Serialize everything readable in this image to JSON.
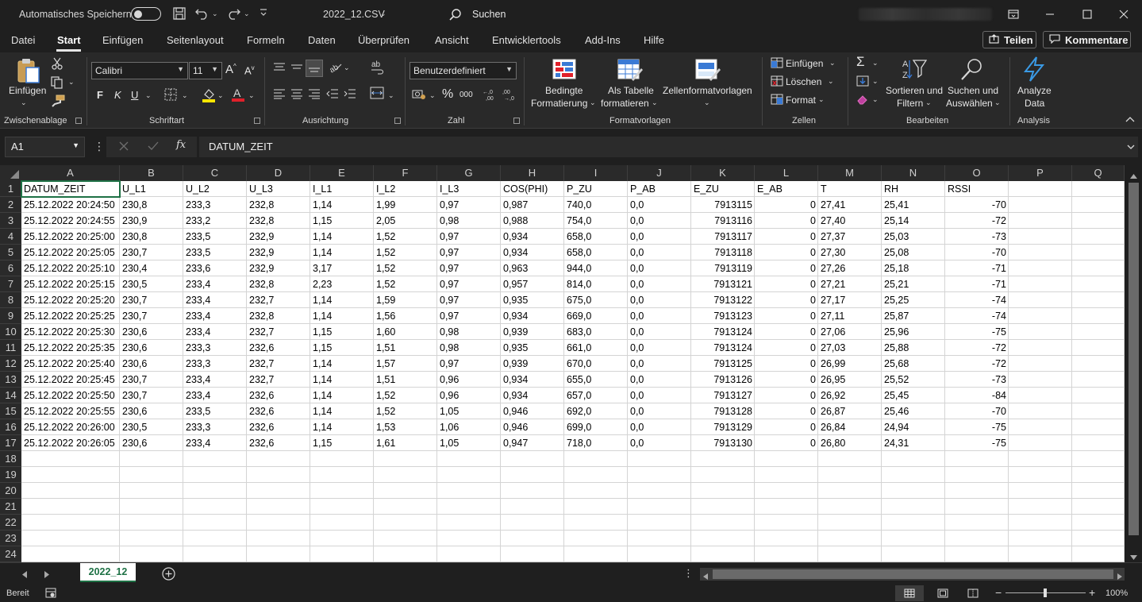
{
  "titlebar": {
    "autosave_label": "Automatisches Speichern",
    "doc_title": "2022_12.CSV",
    "search_label": "Suchen"
  },
  "menu": {
    "tabs": [
      "Datei",
      "Start",
      "Einfügen",
      "Seitenlayout",
      "Formeln",
      "Daten",
      "Überprüfen",
      "Ansicht",
      "Entwicklertools",
      "Add-Ins",
      "Hilfe"
    ],
    "active": "Start",
    "share_label": "Teilen",
    "comments_label": "Kommentare"
  },
  "ribbon": {
    "clipboard": {
      "paste_label": "Einfügen",
      "group_label": "Zwischenablage"
    },
    "font": {
      "name": "Calibri",
      "size": "11",
      "bold": "F",
      "italic": "K",
      "underline": "U",
      "group_label": "Schriftart"
    },
    "alignment": {
      "group_label": "Ausrichtung"
    },
    "number": {
      "format": "Benutzerdefiniert",
      "percent": "%",
      "thousands": "000",
      "group_label": "Zahl"
    },
    "styles": {
      "conditional_line1": "Bedingte",
      "conditional_line2": "Formatierung",
      "table_line1": "Als Tabelle",
      "table_line2": "formatieren",
      "cellstyles_line1": "Zellenformatvorlagen",
      "group_label": "Formatvorlagen"
    },
    "cells": {
      "insert": "Einfügen",
      "delete": "Löschen",
      "format": "Format",
      "group_label": "Zellen"
    },
    "editing": {
      "sort_line1": "Sortieren und",
      "sort_line2": "Filtern",
      "find_line1": "Suchen und",
      "find_line2": "Auswählen",
      "group_label": "Bearbeiten"
    },
    "analysis": {
      "analyze_line1": "Analyze",
      "analyze_line2": "Data",
      "group_label": "Analysis"
    }
  },
  "formula": {
    "cell_ref": "A1",
    "fx": "fx",
    "content": "DATUM_ZEIT"
  },
  "columns": [
    "A",
    "B",
    "C",
    "D",
    "E",
    "F",
    "G",
    "H",
    "I",
    "J",
    "K",
    "L",
    "M",
    "N",
    "O",
    "P",
    "Q"
  ],
  "row_numbers": [
    "1",
    "2",
    "3",
    "4",
    "5",
    "6",
    "7",
    "8",
    "9",
    "10",
    "11",
    "12",
    "13",
    "14",
    "15",
    "16",
    "17",
    "18",
    "19",
    "20",
    "21",
    "22",
    "23",
    "24"
  ],
  "headers": [
    "DATUM_ZEIT",
    "U_L1",
    "U_L2",
    "U_L3",
    "I_L1",
    "I_L2",
    "I_L3",
    "COS(PHI)",
    "P_ZU",
    "P_AB",
    "E_ZU",
    "E_AB",
    "T",
    "RH",
    "RSSI"
  ],
  "rows": [
    [
      " 25.12.2022 20:24:50",
      "230,8",
      "233,3",
      "232,8",
      "1,14",
      "1,99",
      "0,97",
      "0,987",
      "740,0",
      "0,0",
      "7913115",
      "0",
      "27,41",
      "25,41",
      "-70"
    ],
    [
      " 25.12.2022 20:24:55",
      "230,9",
      "233,2",
      "232,8",
      "1,15",
      "2,05",
      "0,98",
      "0,988",
      "754,0",
      "0,0",
      "7913116",
      "0",
      "27,40",
      "25,14",
      "-72"
    ],
    [
      " 25.12.2022 20:25:00",
      "230,8",
      "233,5",
      "232,9",
      "1,14",
      "1,52",
      "0,97",
      "0,934",
      "658,0",
      "0,0",
      "7913117",
      "0",
      "27,37",
      "25,03",
      "-73"
    ],
    [
      " 25.12.2022 20:25:05",
      "230,7",
      "233,5",
      "232,9",
      "1,14",
      "1,52",
      "0,97",
      "0,934",
      "658,0",
      "0,0",
      "7913118",
      "0",
      "27,30",
      "25,08",
      "-70"
    ],
    [
      " 25.12.2022 20:25:10",
      "230,4",
      "233,6",
      "232,9",
      "3,17",
      "1,52",
      "0,97",
      "0,963",
      "944,0",
      "0,0",
      "7913119",
      "0",
      "27,26",
      "25,18",
      "-71"
    ],
    [
      " 25.12.2022 20:25:15",
      "230,5",
      "233,4",
      "232,8",
      "2,23",
      "1,52",
      "0,97",
      "0,957",
      "814,0",
      "0,0",
      "7913121",
      "0",
      "27,21",
      "25,21",
      "-71"
    ],
    [
      " 25.12.2022 20:25:20",
      "230,7",
      "233,4",
      "232,7",
      "1,14",
      "1,59",
      "0,97",
      "0,935",
      "675,0",
      "0,0",
      "7913122",
      "0",
      "27,17",
      "25,25",
      "-74"
    ],
    [
      " 25.12.2022 20:25:25",
      "230,7",
      "233,4",
      "232,8",
      "1,14",
      "1,56",
      "0,97",
      "0,934",
      "669,0",
      "0,0",
      "7913123",
      "0",
      "27,11",
      "25,87",
      "-74"
    ],
    [
      " 25.12.2022 20:25:30",
      "230,6",
      "233,4",
      "232,7",
      "1,15",
      "1,60",
      "0,98",
      "0,939",
      "683,0",
      "0,0",
      "7913124",
      "0",
      "27,06",
      "25,96",
      "-75"
    ],
    [
      " 25.12.2022 20:25:35",
      "230,6",
      "233,3",
      "232,6",
      "1,15",
      "1,51",
      "0,98",
      "0,935",
      "661,0",
      "0,0",
      "7913124",
      "0",
      "27,03",
      "25,88",
      "-72"
    ],
    [
      " 25.12.2022 20:25:40",
      "230,6",
      "233,3",
      "232,7",
      "1,14",
      "1,57",
      "0,97",
      "0,939",
      "670,0",
      "0,0",
      "7913125",
      "0",
      "26,99",
      "25,68",
      "-72"
    ],
    [
      " 25.12.2022 20:25:45",
      "230,7",
      "233,4",
      "232,7",
      "1,14",
      "1,51",
      "0,96",
      "0,934",
      "655,0",
      "0,0",
      "7913126",
      "0",
      "26,95",
      "25,52",
      "-73"
    ],
    [
      " 25.12.2022 20:25:50",
      "230,7",
      "233,4",
      "232,6",
      "1,14",
      "1,52",
      "0,96",
      "0,934",
      "657,0",
      "0,0",
      "7913127",
      "0",
      "26,92",
      "25,45",
      "-84"
    ],
    [
      " 25.12.2022 20:25:55",
      "230,6",
      "233,5",
      "232,6",
      "1,14",
      "1,52",
      "1,05",
      "0,946",
      "692,0",
      "0,0",
      "7913128",
      "0",
      "26,87",
      "25,46",
      "-70"
    ],
    [
      " 25.12.2022 20:26:00",
      "230,5",
      "233,3",
      "232,6",
      "1,14",
      "1,53",
      "1,06",
      "0,946",
      "699,0",
      "0,0",
      "7913129",
      "0",
      "26,84",
      "24,94",
      "-75"
    ],
    [
      " 25.12.2022 20:26:05",
      "230,6",
      "233,4",
      "232,6",
      "1,15",
      "1,61",
      "1,05",
      "0,947",
      "718,0",
      "0,0",
      "7913130",
      "0",
      "26,80",
      "24,31",
      "-75"
    ]
  ],
  "right_aligned_cols": [
    10,
    11,
    14
  ],
  "sheet_tab": "2022_12",
  "status": {
    "ready": "Bereit",
    "zoom": "100%"
  },
  "colors": {
    "accent": "#1e7145",
    "chrome": "#1f1f1f",
    "ribbon": "#292929"
  }
}
